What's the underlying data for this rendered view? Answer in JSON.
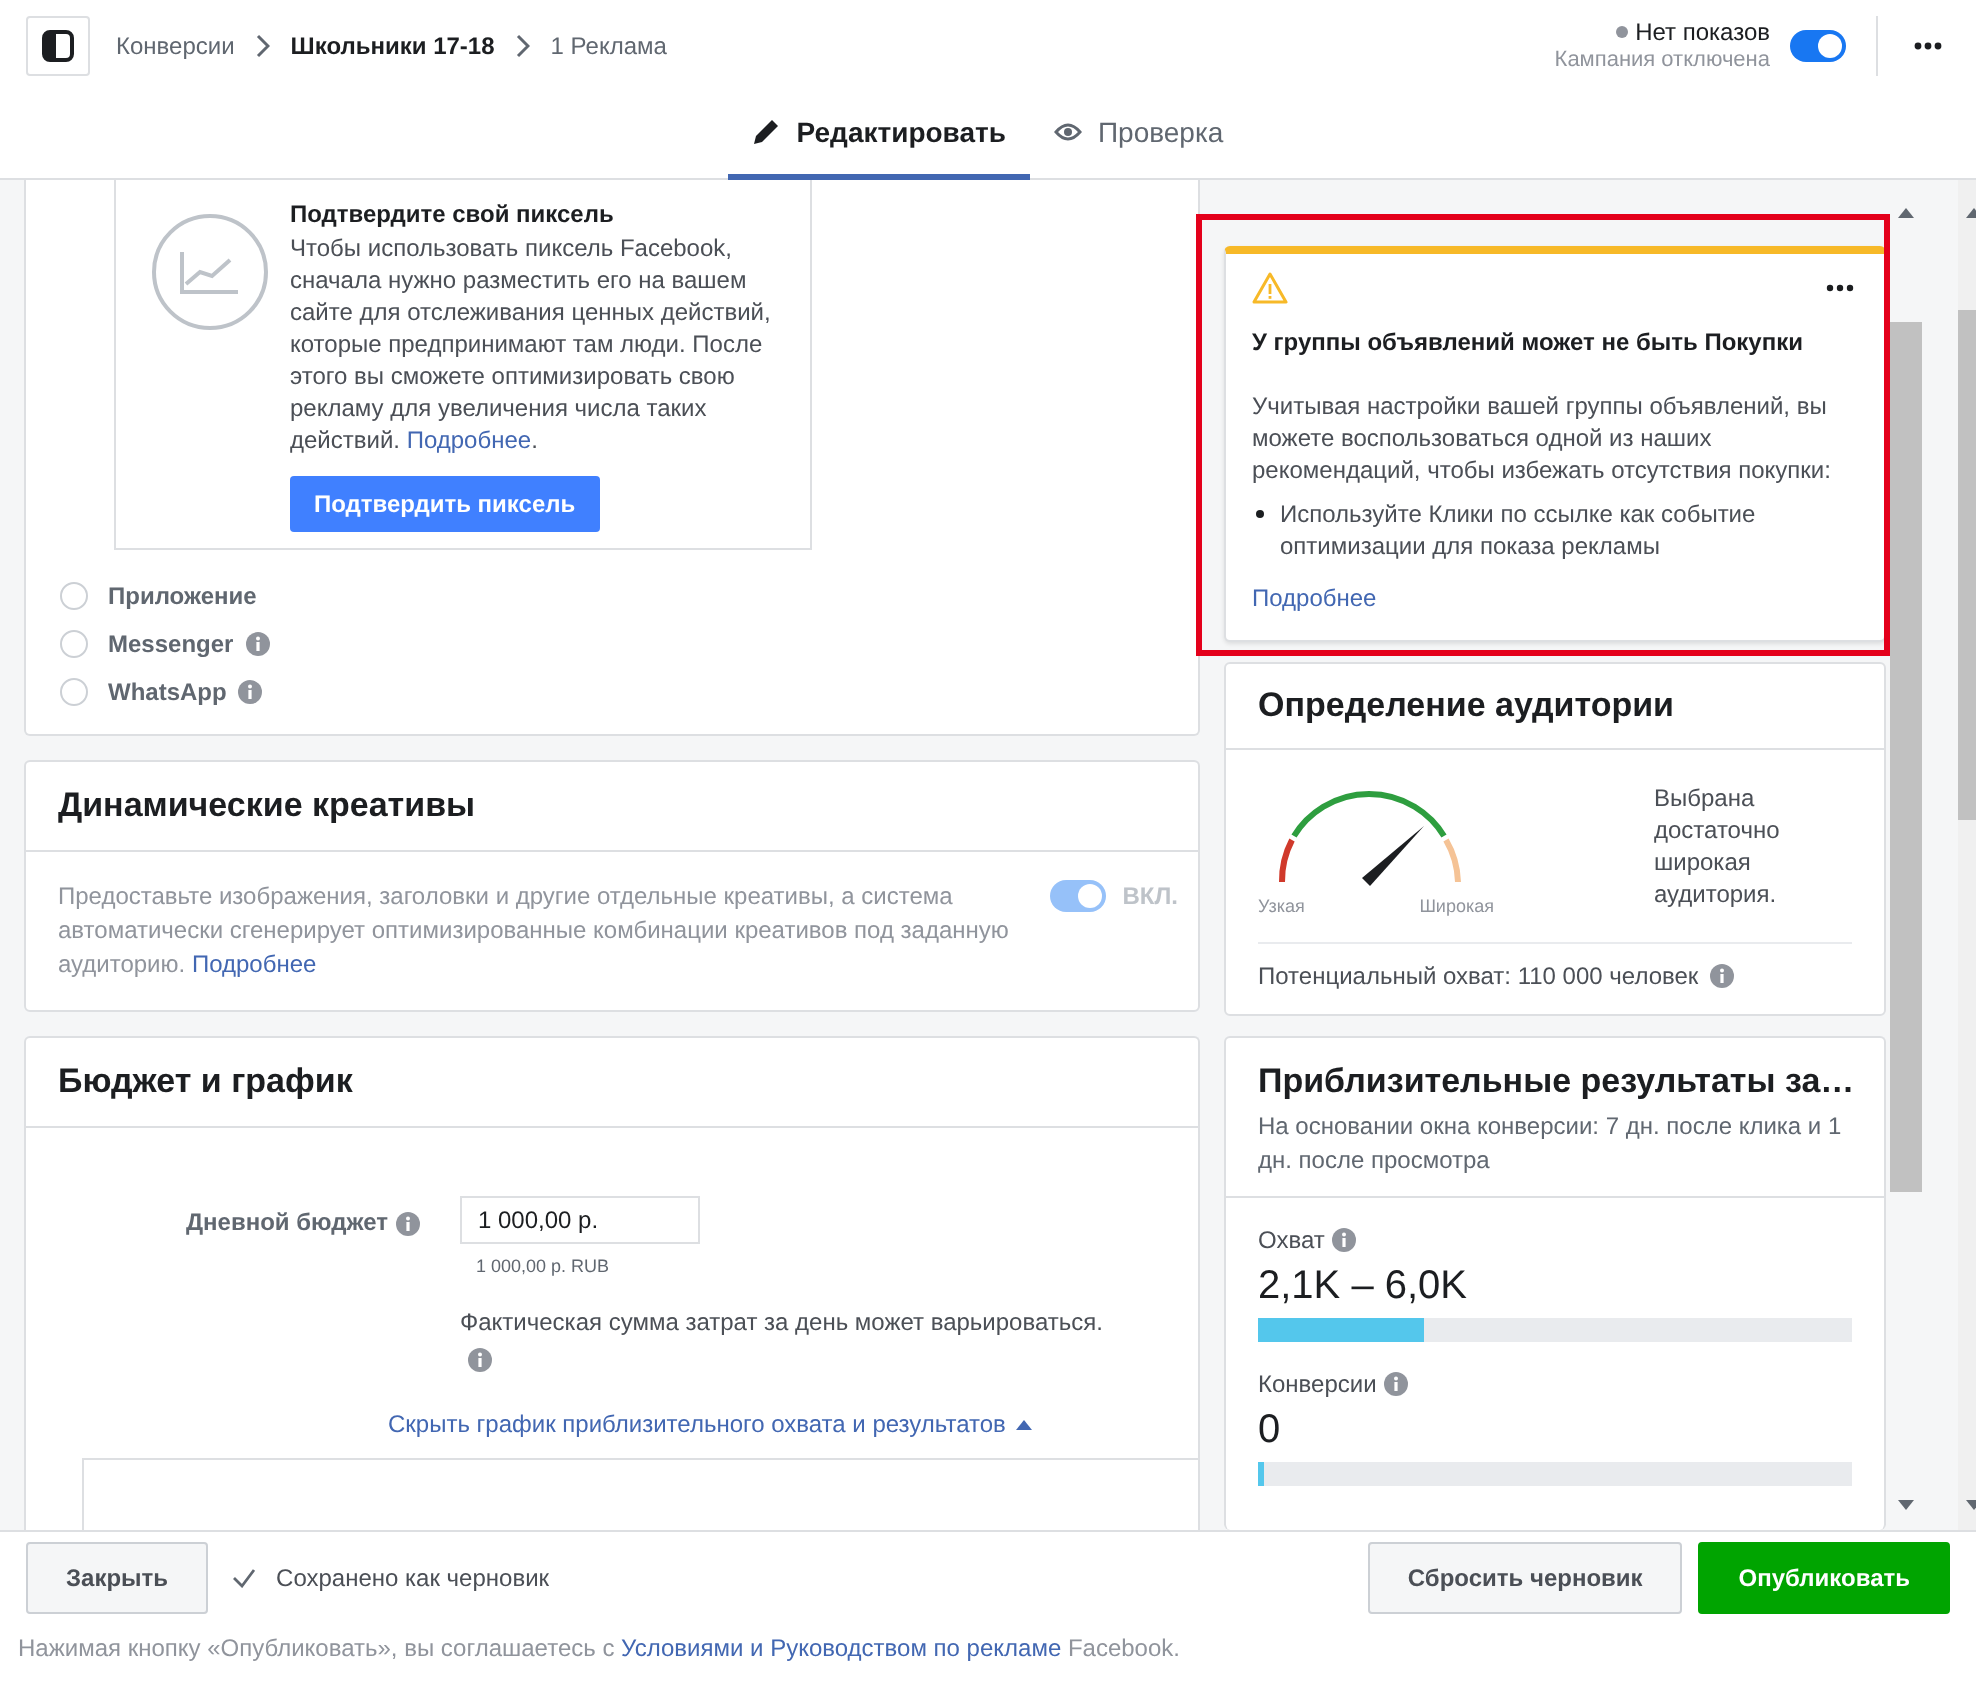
{
  "breadcrumb": [
    {
      "label": "Конверсии",
      "current": false
    },
    {
      "label": "Школьники 17-18",
      "current": true
    },
    {
      "label": "1 Реклама",
      "current": false
    }
  ],
  "campaign_status": {
    "status": "Нет показов",
    "note": "Кампания отключена",
    "on": true
  },
  "tabs": [
    {
      "label": "Редактировать",
      "selected": true
    },
    {
      "label": "Проверка",
      "selected": false
    }
  ],
  "pixel_card": {
    "title": "Подтвердите свой пиксель",
    "text": "Чтобы использовать пиксель Facebook, сначала нужно разместить его на вашем сайте для отслеживания ценных действий, которые предпринимают там люди. После этого вы сможете оптимизировать свою рекламу для увеличения числа таких действий. ",
    "link": "Подробнее",
    "text_after": ".",
    "button": "Подтвердить пиксель"
  },
  "destinations": [
    {
      "label": "Приложение",
      "selected": false,
      "info": false
    },
    {
      "label": "Messenger",
      "selected": false,
      "info": true
    },
    {
      "label": "WhatsApp",
      "selected": false,
      "info": true
    }
  ],
  "dynamic_creative": {
    "title": "Динамические креативы",
    "text": "Предоставьте изображения, заголовки и другие отдельные креативы, а система автоматически сгенерирует оптимизированные комбинации креативов под заданную аудиторию. ",
    "link": "Подробнее",
    "toggle_label": "ВКЛ.",
    "on": true,
    "disabled": true
  },
  "budget": {
    "title": "Бюджет и график",
    "label": "Дневной бюджет",
    "value": "1 000,00 р.",
    "hint": "1 000,00 р. RUB",
    "note": "Фактическая сумма затрат за день может варьироваться.",
    "toggle_link": "Скрыть график приблизительного охвата и результатов"
  },
  "warning": {
    "title": "У группы объявлений может не быть Покупки",
    "text": "Учитывая настройки вашей группы объявлений, вы можете воспользоваться одной из наших рекомендаций, чтобы избежать отсутствия покупки:",
    "bullets": [
      "Используйте Клики по ссылке как событие оптимизации для показа рекламы"
    ],
    "link": "Подробнее"
  },
  "audience": {
    "title": "Определение аудитории",
    "gauge_min": "Узкая",
    "gauge_max": "Широкая",
    "verdict": "Выбрана достаточно широкая аудитория.",
    "potential": "Потенциальный охват: 110 000 человек"
  },
  "estimates": {
    "title": "Приблизительные результаты за…",
    "subtitle": "На основании окна конверсии: 7 дн. после клика и 1 дн. после просмотра",
    "metrics": [
      {
        "label": "Охват",
        "value": "2,1K – 6,0K",
        "level": 0.28
      },
      {
        "label": "Конверсии",
        "value": "0",
        "level": 0.01
      }
    ]
  },
  "footer": {
    "close": "Закрыть",
    "saved": "Сохранено как черновик",
    "reset": "Сбросить черновик",
    "publish": "Опубликовать",
    "legal_before": "Нажимая кнопку «Опубликовать», вы соглашаетесь с ",
    "legal_link": "Условиями и Руководством по рекламе",
    "legal_after": " Facebook."
  }
}
